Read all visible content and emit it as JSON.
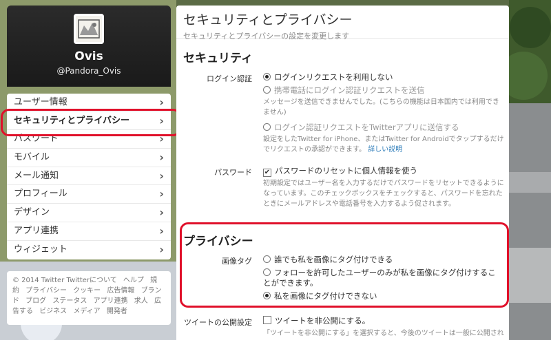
{
  "profile": {
    "name": "Ovis",
    "handle": "@Pandora_Ovis"
  },
  "nav": {
    "items": [
      {
        "label": "ユーザー情報"
      },
      {
        "label": "セキュリティとプライバシー"
      },
      {
        "label": "パスワード"
      },
      {
        "label": "モバイル"
      },
      {
        "label": "メール通知"
      },
      {
        "label": "プロフィール"
      },
      {
        "label": "デザイン"
      },
      {
        "label": "アプリ連携"
      },
      {
        "label": "ウィジェット"
      }
    ],
    "active_index": 1
  },
  "footer": {
    "copyright": "© 2014 Twitter",
    "links": [
      "Twitterについて",
      "ヘルプ",
      "規約",
      "プライバシー",
      "クッキー",
      "広告情報",
      "ブランド",
      "ブログ",
      "ステータス",
      "アプリ連携",
      "求人",
      "広告する",
      "ビジネス",
      "メディア",
      "開発者"
    ]
  },
  "main": {
    "title": "セキュリティとプライバシー",
    "subtitle": "セキュリティとプライバシーの設定を変更します",
    "security": {
      "title": "セキュリティ",
      "login_label": "ログイン認証",
      "opt_none": "ログインリクエストを利用しない",
      "opt_phone": "携帯電話にログイン認証リクエストを送信",
      "opt_phone_note": "メッセージを送信できませんでした。(こちらの機能は日本国内では利用できません)",
      "opt_app": "ログイン認証リクエストをTwitterアプリに送信する",
      "opt_app_note": "設定をしたTwitter for iPhone、またはTwitter for Androidでタップするだけでリクエストの承認ができます。",
      "opt_app_link": "詳しい説明",
      "password_label": "パスワード",
      "password_opt": "パスワードのリセットに個人情報を使う",
      "password_note": "初期設定ではユーザー名を入力するだけでパスワードをリセットできるようになっています。このチェックボックスをチェックすると、パスワードを忘れたときにメールアドレスや電話番号を入力するよう促されます。"
    },
    "privacy": {
      "title": "プライバシー",
      "tag_label": "画像タグ",
      "tag_opt1": "誰でも私を画像にタグ付けできる",
      "tag_opt2": "フォローを許可したユーザーのみが私を画像にタグ付けすることができます。",
      "tag_opt3": "私を画像にタグ付けできない",
      "tweet_label": "ツイートの公開設定",
      "tweet_opt": "ツイートを非公開にする。",
      "tweet_note": "「ツイートを非公開にする」を選択すると、今後のツイートは一般に公開され"
    }
  },
  "colors": {
    "highlight": "#e0102a",
    "link": "#2b7bb9"
  }
}
